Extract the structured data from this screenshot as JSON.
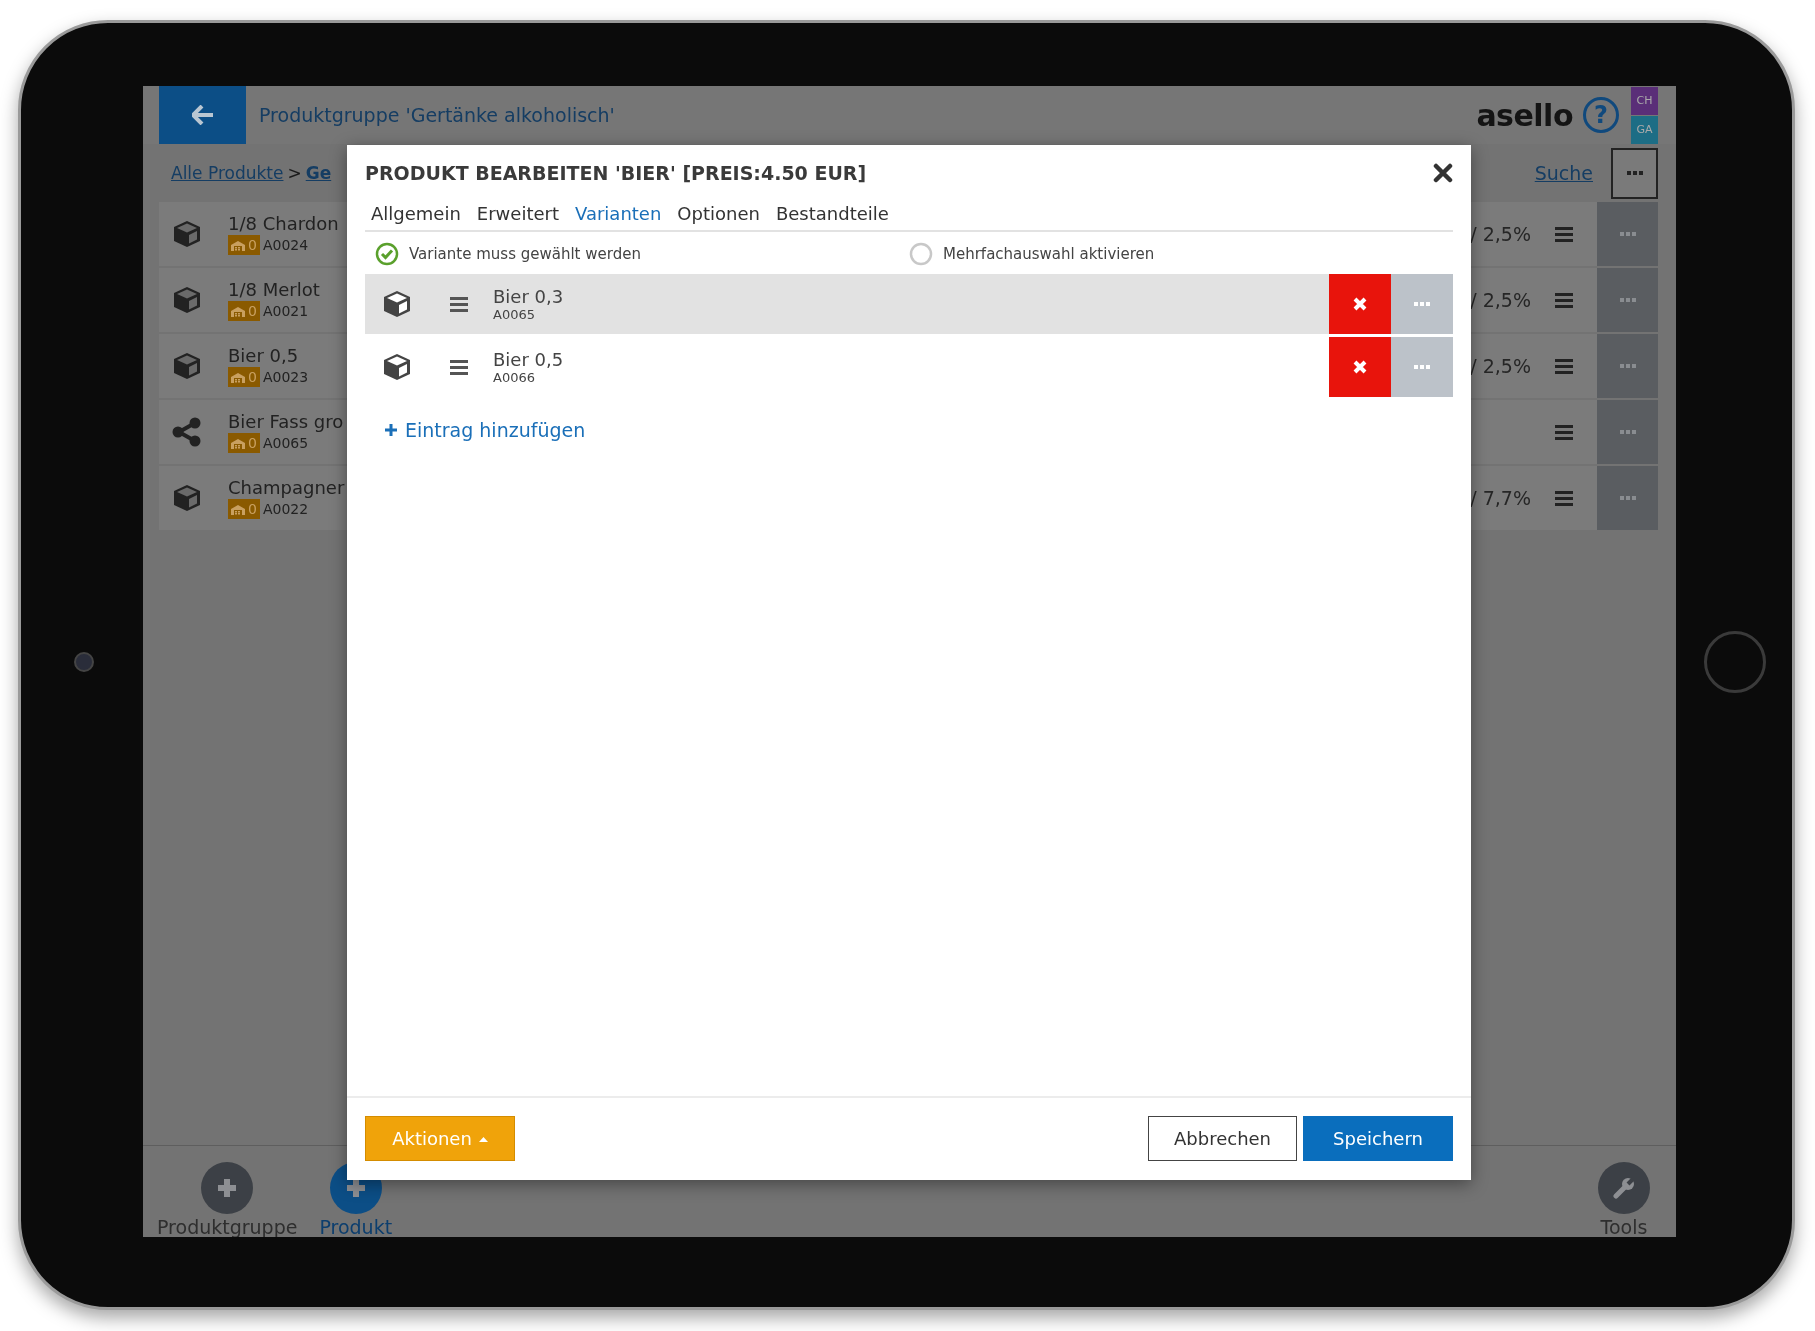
{
  "header": {
    "title": "Produktgruppe 'Gertänke alkoholisch'",
    "logo": "asello",
    "help": "?",
    "tags": [
      {
        "label": "CH",
        "color": "#5a2e78"
      },
      {
        "label": "GA",
        "color": "#1d6d85"
      }
    ]
  },
  "breadcrumb": {
    "items": [
      {
        "label": "Alle Produkte",
        "current": false
      },
      {
        "label": "Ge",
        "current": true
      }
    ],
    "separator": ">"
  },
  "search_link": "Suche",
  "products": [
    {
      "kind": "product",
      "name": "1/8 Chardon",
      "stock": "0",
      "code": "A0024",
      "rate": "/ 2,5%"
    },
    {
      "kind": "product",
      "name": "1/8 Merlot",
      "stock": "0",
      "code": "A0021",
      "rate": "/ 2,5%"
    },
    {
      "kind": "product",
      "name": "Bier 0,5",
      "stock": "0",
      "code": "A0023",
      "rate": "/ 2,5%"
    },
    {
      "kind": "bundle",
      "name": "Bier Fass gro",
      "stock": "0",
      "code": "A0065"
    },
    {
      "kind": "product",
      "name": "Champagner",
      "stock": "0",
      "code": "A0022",
      "rate": "/ 7,7%"
    }
  ],
  "bottom_bar": [
    {
      "kind": "add",
      "label": "Produktgruppe",
      "selected": false
    },
    {
      "kind": "add",
      "label": "Produkt",
      "selected": true
    },
    {
      "kind": "tools",
      "label": "Tools",
      "selected": false
    }
  ],
  "dialog": {
    "title": "PRODUKT BEARBEITEN 'BIER' [PREIS:4.50 EUR]",
    "tabs": [
      {
        "label": "Allgemein",
        "selected": false
      },
      {
        "label": "Erweitert",
        "selected": false
      },
      {
        "label": "Varianten",
        "selected": true
      },
      {
        "label": "Optionen",
        "selected": false
      },
      {
        "label": "Bestandteile",
        "selected": false
      }
    ],
    "options": [
      {
        "label": "Variante muss gewählt werden",
        "checked": true
      },
      {
        "label": "Mehrfachauswahl aktivieren",
        "checked": false
      }
    ],
    "variants": [
      {
        "name": "Bier 0,3",
        "code": "A0065",
        "highlighted": true
      },
      {
        "name": "Bier 0,5",
        "code": "A0066",
        "highlighted": false
      }
    ],
    "add_link": "Eintrag hinzufügen",
    "actions_button": "Aktionen",
    "cancel_button": "Abbrechen",
    "save_button": "Speichern"
  }
}
